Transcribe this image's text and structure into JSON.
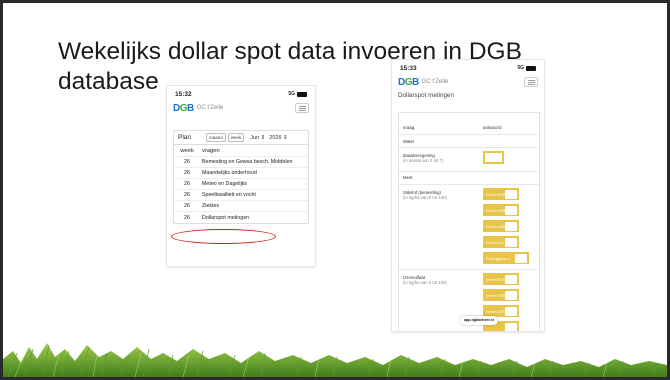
{
  "slide": {
    "title": "Wekelijks dollar spot data invoeren in DGB database"
  },
  "colors": {
    "accent_blue": "#1f6fd1",
    "accent_green": "#3aa84a",
    "highlight_red": "#d21c1c",
    "input_yellow": "#e8c54a"
  },
  "phone1": {
    "status_time": "15:32",
    "status_signal": "5G",
    "logo_letters": [
      "D",
      "G",
      "B"
    ],
    "logo_subtitle": "GC t'Zelle",
    "plan": {
      "label": "Plan",
      "toggle_month": "maand",
      "toggle_week": "week",
      "month_select": "Jun",
      "year_select": "2026"
    },
    "table": {
      "headers": [
        "week",
        "vragen"
      ],
      "rows": [
        {
          "week": "26",
          "label": "Bemesting en Gewas besch. Middelen"
        },
        {
          "week": "26",
          "label": "Maandelijks onderhoud"
        },
        {
          "week": "26",
          "label": "Meteo en Dagelijks"
        },
        {
          "week": "26",
          "label": "Speelkwaliteit en vocht"
        },
        {
          "week": "26",
          "label": "Ziektes"
        },
        {
          "week": "26",
          "label": "Dollarspot metingen"
        }
      ]
    }
  },
  "phone2": {
    "status_time": "15:33",
    "status_signal": "5G",
    "logo_subtitle": "GC t'Zelle",
    "page_title": "Dollarspot metingen",
    "col_vraag": "vraag",
    "col_antwoord": "antwoord",
    "section_water": "Water",
    "dauw_label": "dauwberegening",
    "dauw_sub": "(in aantal van 0 tot 7)",
    "section_mest": "Mest",
    "stikstof_label": "Stikstof (bemesting)",
    "stikstof_sub": "(in kg/ha van 0 tot 100)",
    "stikstof_inputs": [
      "Green RGB",
      "Green YGB",
      "Green 18GB",
      "Green 14L",
      "Puttinggreen 1"
    ],
    "ijzer_label": "IJzersulfaat",
    "ijzer_sub": "(in kg/ha van 0 tot 100)",
    "ijzer_inputs": [
      "Green RGB",
      "Green YGB",
      "Green 18GB"
    ],
    "url": "app.dgbbeheer.nl"
  }
}
